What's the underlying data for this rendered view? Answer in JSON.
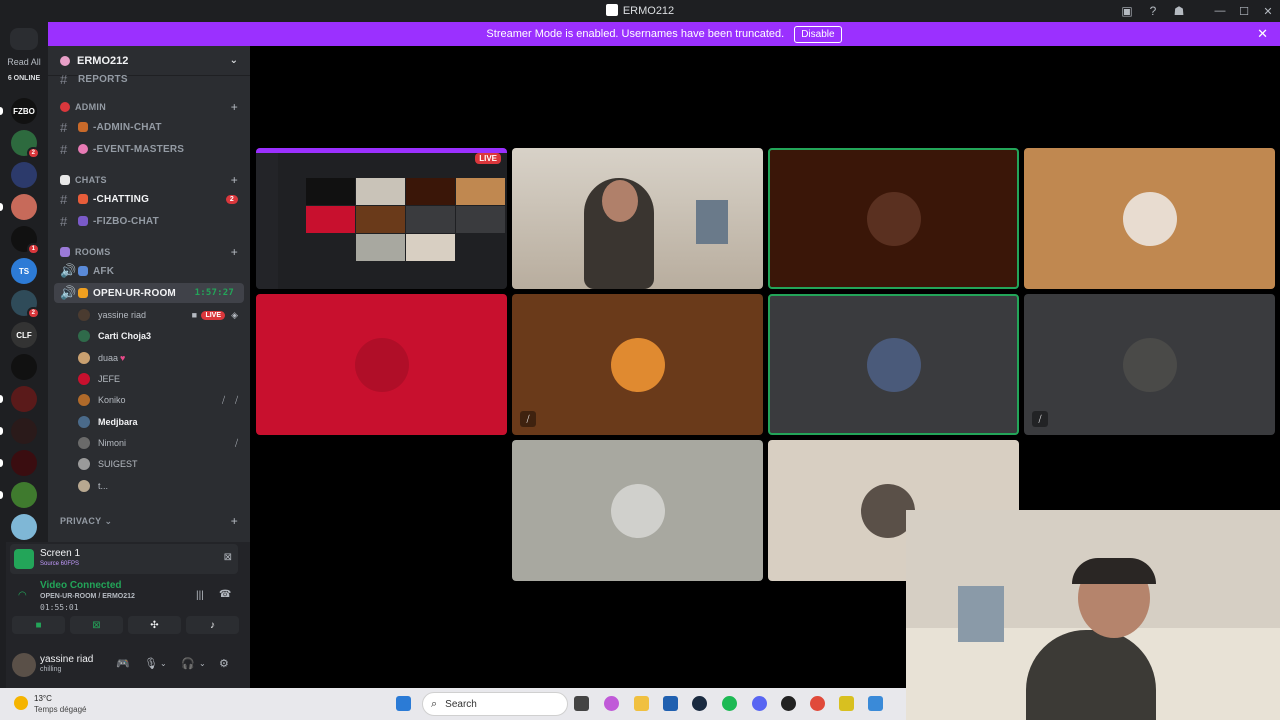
{
  "window": {
    "title": "ERMO212"
  },
  "rail": {
    "read_all": "Read All",
    "online": "6 ONLINE",
    "servers": [
      {
        "label": "FZBO"
      },
      {
        "label": "",
        "badge": "2"
      },
      {
        "label": ""
      },
      {
        "label": ""
      },
      {
        "label": "",
        "badge": "1"
      },
      {
        "label": "TS"
      },
      {
        "label": "",
        "badge": "2"
      },
      {
        "label": "CLF"
      },
      {
        "label": ""
      },
      {
        "label": ""
      },
      {
        "label": ""
      },
      {
        "label": ""
      },
      {
        "label": ""
      },
      {
        "label": ""
      }
    ]
  },
  "banner": {
    "text": "Streamer Mode is enabled. Usernames have been truncated.",
    "disable_label": "Disable"
  },
  "guild": {
    "name": "ERMO212"
  },
  "sidebar": {
    "cut_channel": "REPORTS",
    "cat_admin": "ADMIN",
    "ch_admin_chat": "-ADMIN-CHAT",
    "ch_event_masters": "-EVENT-MASTERS",
    "cat_chats": "CHATS",
    "ch_chatting": "-CHATTING",
    "ch_chatting_badge": "2",
    "ch_fizbo_chat": "-FIZBO-CHAT",
    "cat_rooms": "ROOMS",
    "ch_afk": "AFK",
    "ch_open_ur_room": "OPEN-UR-ROOM",
    "ch_open_ur_room_time": "1:57:27",
    "users": [
      {
        "name": "yassine riad",
        "live": "LIVE"
      },
      {
        "name": "Carti Choja3"
      },
      {
        "name": "duaa"
      },
      {
        "name": "JEFE"
      },
      {
        "name": "Koniko"
      },
      {
        "name": "Medjbara"
      },
      {
        "name": "Nimoni"
      },
      {
        "name": "SUIGEST"
      },
      {
        "name": "t..."
      }
    ],
    "cat_privacy": "PRIVACY"
  },
  "voice": {
    "screen_title": "Screen 1",
    "screen_sub": "Source 60FPS",
    "connected": "Video Connected",
    "channel": "OPEN-UR-ROOM / ERMO212",
    "elapsed": "01:55:01"
  },
  "user": {
    "name": "yassine riad",
    "status": "chilling"
  },
  "stage": {
    "live_label": "LIVE"
  },
  "taskbar": {
    "temp": "13°C",
    "weather": "Temps dégagé",
    "search_placeholder": "Search"
  },
  "colors": {
    "brand": "#5865f2",
    "banner": "#9b30ff",
    "speaking": "#23a559",
    "live": "#da373c"
  }
}
